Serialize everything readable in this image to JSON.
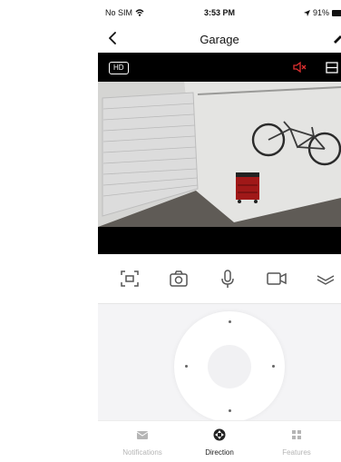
{
  "status_bar": {
    "carrier": "No SIM",
    "time": "3:53 PM",
    "battery": "91%"
  },
  "header": {
    "title": "Garage"
  },
  "video": {
    "quality_badge": "HD"
  },
  "tabs": [
    {
      "label": "Notifications",
      "icon": "envelope-icon",
      "active": false
    },
    {
      "label": "Direction",
      "icon": "direction-icon",
      "active": true
    },
    {
      "label": "Features",
      "icon": "grid-icon",
      "active": false
    }
  ],
  "colors": {
    "mute_icon": "#e03030",
    "active_tab": "#222222",
    "inactive_tab": "#b5b5b5",
    "video_bg": "#000000"
  }
}
